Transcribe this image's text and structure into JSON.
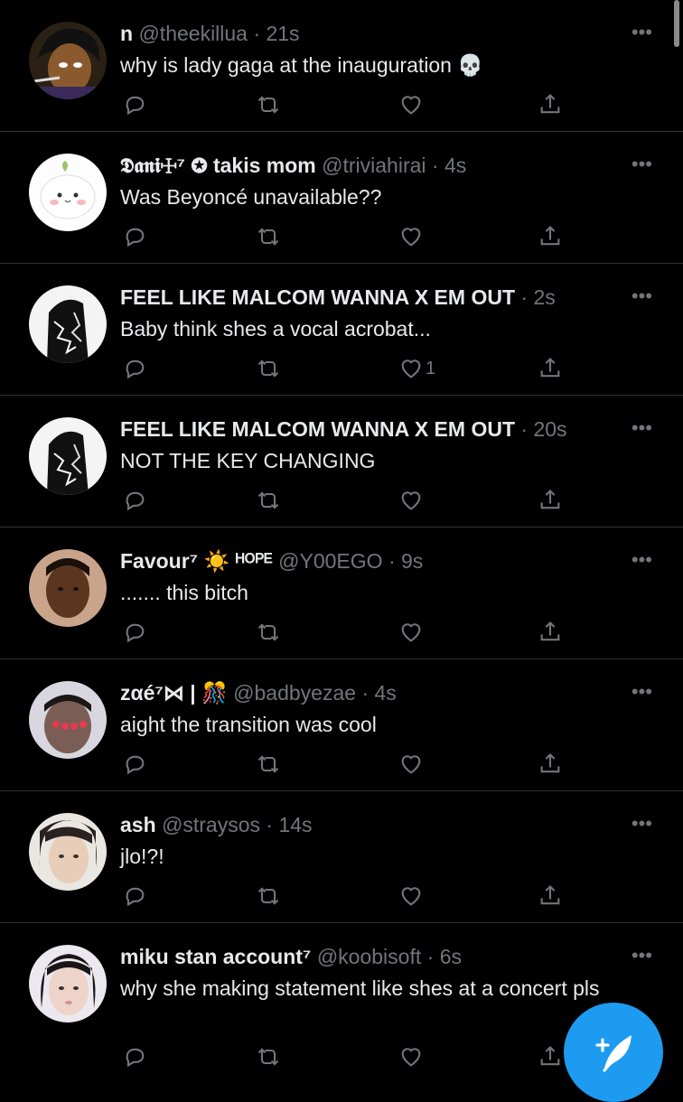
{
  "tweets": [
    {
      "name": "n",
      "decor": "",
      "handle": "@theekillua",
      "time": "21s",
      "text": "why is lady gaga at the inauguration 💀",
      "likes": ""
    },
    {
      "name": "𝕯𝖆𝖓𝖎☩⁷ ✪ takis mom",
      "decor": "",
      "handle": "@triviahirai",
      "time": "4s",
      "text": "Was Beyoncé unavailable??",
      "likes": ""
    },
    {
      "name": "FEEL LIKE MALCOM WANNA X EM OUT",
      "decor": "",
      "handle": "",
      "time": "2s",
      "text": "Baby think shes a vocal acrobat...",
      "likes": "1"
    },
    {
      "name": "FEEL LIKE MALCOM WANNA X EM OUT",
      "decor": "",
      "handle": "",
      "time": "20s",
      "text": "NOT THE KEY CHANGING",
      "likes": ""
    },
    {
      "name": "Favour⁷",
      "decor": "☀️ ᴴᴼᴾᴱ",
      "handle": "@Y00EGO",
      "time": "9s",
      "text": "....... this bitch",
      "likes": ""
    },
    {
      "name": "zαé⁷⋈ |",
      "decor": "🎊",
      "handle": "@badbyezae",
      "time": "4s",
      "text": "aight the transition was cool",
      "likes": ""
    },
    {
      "name": "ash",
      "decor": "",
      "handle": "@straysos",
      "time": "14s",
      "text": "jlo!?!",
      "likes": ""
    },
    {
      "name": "miku stan account⁷",
      "decor": "",
      "handle": "@koobisoft",
      "time": "6s",
      "text": "why she making statement like shes at a concert pls",
      "likes": ""
    }
  ],
  "more_glyph": "•••",
  "time_separator": "·",
  "compose_icon": "feather-plus-icon",
  "colors": {
    "background": "#000000",
    "text": "#e7e9ea",
    "secondary": "#71767b",
    "accent": "#1d9bf0",
    "divider": "#2f3336"
  }
}
